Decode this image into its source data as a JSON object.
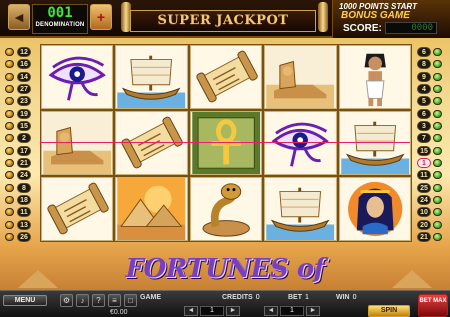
{
  "top_bar": {
    "denomination_value": "001",
    "denomination_label": "DENOMINATION",
    "decrease_symbol": "◄",
    "increase_symbol": "+",
    "jackpot_label": "SUPER JACKPOT",
    "bonus_line1": "1000 POINTS START",
    "bonus_line2": "BONUS GAME",
    "score_label": "SCORE:",
    "score_value": "0000"
  },
  "paylines": {
    "left": [
      "12",
      "16",
      "14",
      "27",
      "23",
      "19",
      "15",
      "2",
      "17",
      "21",
      "24",
      "8",
      "18",
      "11",
      "13",
      "26"
    ],
    "right": [
      "6",
      "8",
      "9",
      "4",
      "5",
      "6",
      "3",
      "7",
      "15",
      "1",
      "11",
      "25",
      "24",
      "10",
      "20",
      "21"
    ],
    "active_line": "1"
  },
  "reels": [
    [
      "eye-of-horus",
      "sphinx",
      "papyrus-scroll"
    ],
    [
      "ship",
      "papyrus-scroll",
      "pyramids"
    ],
    [
      "papyrus-scroll",
      "ankh",
      "cobra"
    ],
    [
      "sphinx",
      "eye-of-horus",
      "ship"
    ],
    [
      "pharaoh-man",
      "ship",
      "cleopatra"
    ]
  ],
  "logo_text": "FORTUNES of EGYPT",
  "bottom_bar": {
    "menu_label": "MENU",
    "game_label": "GAME",
    "balance": "€0.00",
    "credits_label": "CREDITS",
    "credits_value": "0",
    "bet_label": "BET",
    "bet_value": "1",
    "win_label": "WIN",
    "win_value": "0",
    "lines_value": "1",
    "bet_per_line_value": "1",
    "spin_label": "SPIN",
    "betmax_label": "BET MAX"
  },
  "colors": {
    "payline": "#e8206a",
    "logo": "#7a3fc0",
    "digit_green": "#39e83a"
  }
}
